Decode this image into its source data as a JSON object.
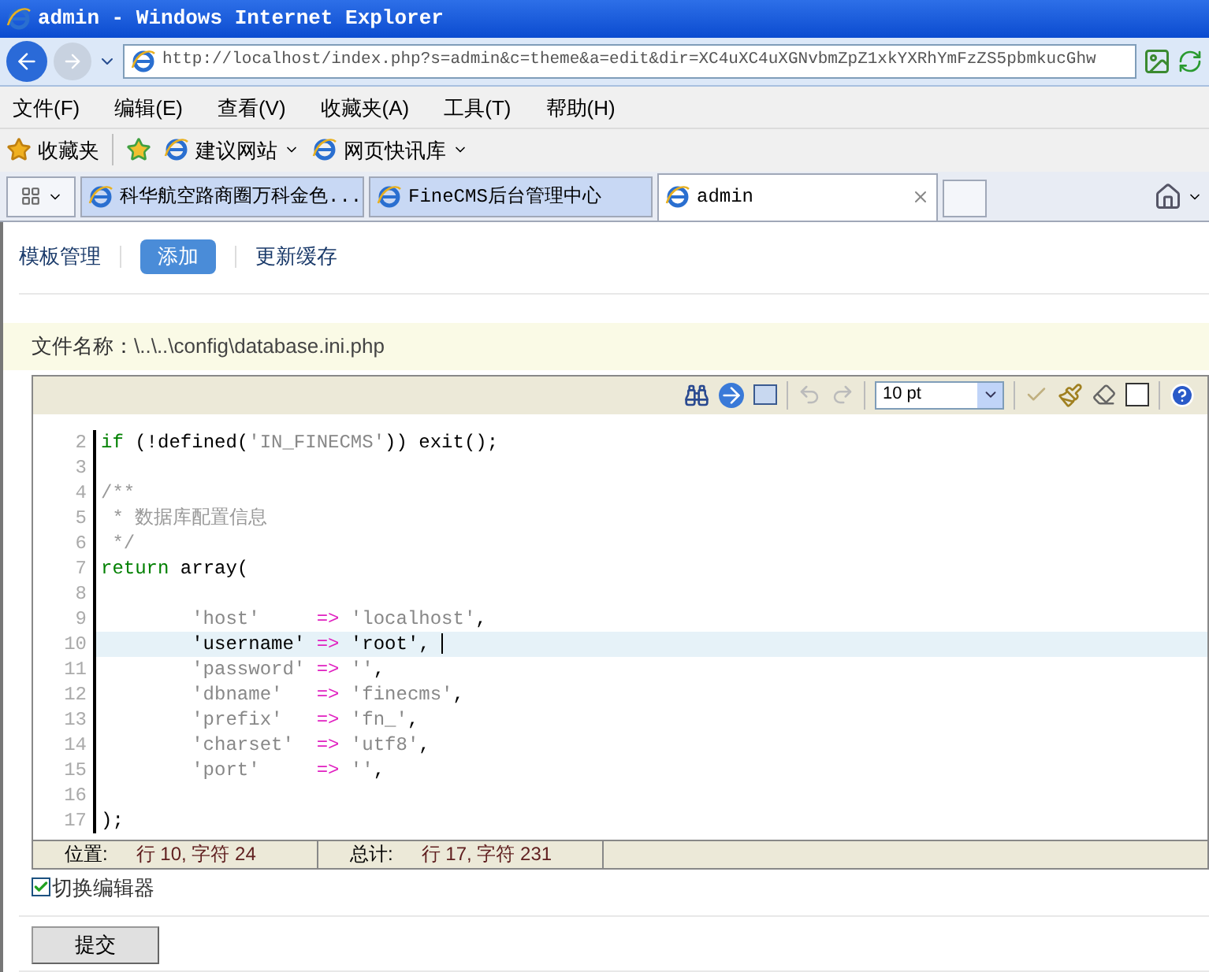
{
  "window": {
    "title": "admin - Windows Internet Explorer"
  },
  "address": {
    "value": "http://localhost/index.php?s=admin&c=theme&a=edit&dir=XC4uXC4uXGNvbmZpZ1xkYXRhYmFzZS5pbmkucGhw"
  },
  "menu": [
    "文件(F)",
    "编辑(E)",
    "查看(V)",
    "收藏夹(A)",
    "工具(T)",
    "帮助(H)"
  ],
  "favorites_bar": {
    "favorites": "收藏夹",
    "links": [
      "建议网站",
      "网页快讯库"
    ]
  },
  "tabs": [
    {
      "label": "科华航空路商圈万科金色...",
      "selected": false
    },
    {
      "label": "FineCMS后台管理中心",
      "selected": false
    },
    {
      "label": "admin",
      "selected": true
    }
  ],
  "nav": [
    {
      "label": "模板管理",
      "selected": false
    },
    {
      "label": "添加",
      "selected": true
    },
    {
      "label": "更新缓存",
      "selected": false
    }
  ],
  "file_name": {
    "label": "文件名称：",
    "value": "\\..\\..\\config\\database.ini.php"
  },
  "editor": {
    "font_size": "10 pt",
    "lines": [
      {
        "number": "2",
        "selected": false,
        "tokens": [
          {
            "kind": "keyword",
            "text": "if"
          },
          {
            "kind": "plain",
            "text": " (!defined("
          },
          {
            "kind": "string",
            "text": "'IN_FINECMS'"
          },
          {
            "kind": "plain",
            "text": ")) exit();"
          }
        ]
      },
      {
        "number": "3",
        "selected": false
      },
      {
        "number": "4",
        "selected": false,
        "tokens": [
          {
            "kind": "comment",
            "text": "/**"
          }
        ]
      },
      {
        "number": "5",
        "selected": false,
        "tokens": [
          {
            "kind": "comment",
            "text": " * 数据库配置信息"
          }
        ]
      },
      {
        "number": "6",
        "selected": false,
        "tokens": [
          {
            "kind": "comment",
            "text": " */"
          }
        ]
      },
      {
        "number": "7",
        "selected": false,
        "tokens": [
          {
            "kind": "keyword",
            "text": "return"
          },
          {
            "kind": "plain",
            "text": " array("
          }
        ]
      },
      {
        "number": "8",
        "selected": false
      },
      {
        "number": "9",
        "selected": false,
        "tokens": [
          {
            "kind": "string",
            "text": "        'host'     "
          },
          {
            "kind": "operator",
            "text": "=>"
          },
          {
            "kind": "string",
            "text": " 'localhost'"
          },
          {
            "kind": "plain",
            "text": ","
          }
        ]
      },
      {
        "number": "10",
        "selected": true,
        "tokens": [
          {
            "kind": "string",
            "text": "        'username'"
          },
          {
            "kind": "operator",
            "text": " =>"
          },
          {
            "kind": "string",
            "text": " 'root'"
          },
          {
            "kind": "plain",
            "text": ", "
          }
        ]
      },
      {
        "number": "11",
        "selected": false,
        "tokens": [
          {
            "kind": "string",
            "text": "        'password'"
          },
          {
            "kind": "operator",
            "text": " =>"
          },
          {
            "kind": "string",
            "text": " ''"
          },
          {
            "kind": "plain",
            "text": ","
          }
        ]
      },
      {
        "number": "12",
        "selected": false,
        "tokens": [
          {
            "kind": "string",
            "text": "        'dbname'   "
          },
          {
            "kind": "operator",
            "text": "=>"
          },
          {
            "kind": "string",
            "text": " 'finecms'"
          },
          {
            "kind": "plain",
            "text": ","
          }
        ]
      },
      {
        "number": "13",
        "selected": false,
        "tokens": [
          {
            "kind": "string",
            "text": "        'prefix'   "
          },
          {
            "kind": "operator",
            "text": "=>"
          },
          {
            "kind": "string",
            "text": " 'fn_'"
          },
          {
            "kind": "plain",
            "text": ","
          }
        ]
      },
      {
        "number": "14",
        "selected": false,
        "tokens": [
          {
            "kind": "string",
            "text": "        'charset'  "
          },
          {
            "kind": "operator",
            "text": "=>"
          },
          {
            "kind": "string",
            "text": " 'utf8'"
          },
          {
            "kind": "plain",
            "text": ","
          }
        ]
      },
      {
        "number": "15",
        "selected": false,
        "tokens": [
          {
            "kind": "string",
            "text": "        'port'     "
          },
          {
            "kind": "operator",
            "text": "=>"
          },
          {
            "kind": "string",
            "text": " ''"
          },
          {
            "kind": "plain",
            "text": ","
          }
        ]
      },
      {
        "number": "16",
        "selected": false
      },
      {
        "number": "17",
        "selected": false,
        "tokens": [
          {
            "kind": "plain",
            "text": ");"
          }
        ]
      }
    ],
    "status": [
      {
        "label": "位置:",
        "value": "行 10, 字符 24"
      },
      {
        "label": "总计:",
        "value": "行 17, 字符 231"
      }
    ]
  },
  "switch_editor": {
    "label": "切换编辑器",
    "checked": true
  },
  "submit": "提交"
}
